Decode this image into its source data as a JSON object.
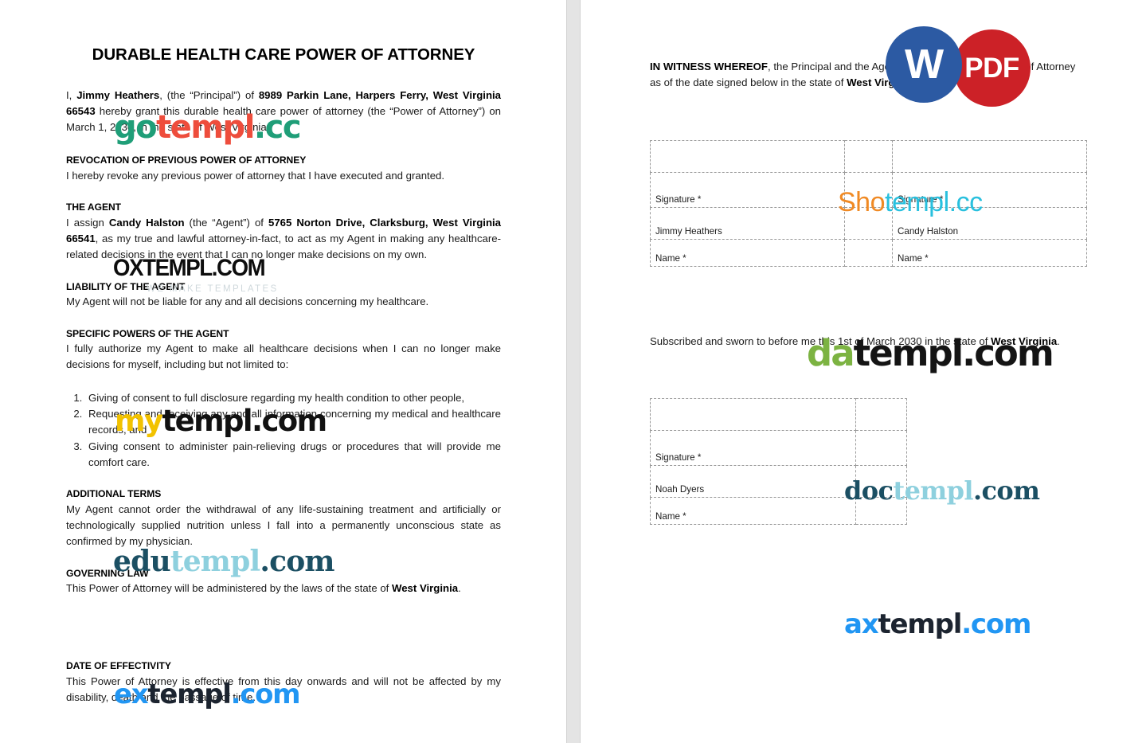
{
  "document": {
    "title": "DURABLE HEALTH CARE POWER OF ATTORNEY",
    "intro": {
      "lead": "I, ",
      "principal_name": "Jimmy Heathers",
      "mid1": ", (the “Principal”) of ",
      "principal_address": "8989 Parkin Lane, Harpers Ferry, West Virginia 66543",
      "tail": " hereby grant this durable health care power of attorney (the “Power of Attorney”) on March 1, 2030, in the state of West Virginia."
    },
    "sections": {
      "revocation": {
        "heading": "REVOCATION OF PREVIOUS POWER OF ATTORNEY",
        "body": "I hereby revoke any previous power of attorney that I have executed and granted."
      },
      "agent": {
        "heading": "THE AGENT",
        "lead": "I assign ",
        "agent_name": "Candy Halston",
        "mid": " (the “Agent”) of ",
        "agent_address": "5765 Norton Drive, Clarksburg, West Virginia 66541",
        "tail": ", as my true and lawful attorney-in-fact, to act as my Agent in making any healthcare-related decisions in the event that I can no longer make decisions on my own."
      },
      "liability": {
        "heading": "LIABILITY OF THE AGENT",
        "body": "My Agent will not be liable for any and all decisions concerning my healthcare."
      },
      "specific_powers": {
        "heading": "SPECIFIC POWERS OF THE AGENT",
        "body": "I fully authorize my Agent to make all healthcare decisions when I can no longer make decisions for myself, including but not limited to:",
        "items": [
          "Giving of consent to full disclosure regarding my health condition to other people,",
          "Requesting and receiving any and all information concerning my medical and healthcare records, and",
          "Giving consent to administer pain-relieving drugs or procedures that will provide me comfort care."
        ]
      },
      "additional_terms": {
        "heading": "ADDITIONAL TERMS",
        "body": "My Agent cannot order the withdrawal of any life-sustaining treatment and artificially or technologically supplied nutrition unless I fall into a permanently unconscious state as confirmed by my physician."
      },
      "governing_law": {
        "heading": "GOVERNING LAW",
        "lead": "This Power of Attorney will be administered by the laws of the state of ",
        "state": "West Virginia",
        "tail": "."
      },
      "date_of_effectivity": {
        "heading": "DATE OF EFFECTIVITY",
        "body": "This Power of Attorney is effective from this day onwards and will not be affected by my disability, death and the passage of time."
      }
    },
    "page2": {
      "witness": {
        "lead_bold": "IN WITNESS WHEREOF",
        "mid": ", the Principal and the Agent have executed this Power of Attorney as of the date signed below in the state of ",
        "state": "West Virginia",
        "tail": "."
      },
      "signature_table": {
        "left": {
          "signature_label": "Signature *",
          "name_value": "Jimmy Heathers",
          "name_label": "Name *"
        },
        "right": {
          "signature_label": "Signature *",
          "name_value": "Candy Halston",
          "name_label": "Name *"
        }
      },
      "notary": {
        "lead": "Subscribed and sworn to before me this 1st of March 2030 in the state of ",
        "state": "West Virginia",
        "tail": "."
      },
      "notary_table": {
        "signature_label": "Signature *",
        "name_value": "Noah Dyers",
        "name_label": "Name *"
      }
    }
  },
  "badges": {
    "word": {
      "label": "W",
      "color": "#2c5aa3"
    },
    "pdf": {
      "label": "PDF",
      "color": "#cc2127"
    }
  },
  "watermarks": {
    "gotempl": {
      "p1": "go",
      "p2": "templ",
      "p3": ".cc"
    },
    "oxtempl": {
      "main": "OXTEMPL.COM",
      "sub": "WE MAKE TEMPLATES"
    },
    "mytempl": {
      "p1": "my",
      "p2": "templ.com"
    },
    "edutempl": {
      "p1": "edu",
      "p2": "templ",
      "p3": ".com"
    },
    "extempl": {
      "p1": "ex",
      "p2": "templ",
      "p3": ".com"
    },
    "shotempl": {
      "p1": "Sho",
      "p2": "templ.cc"
    },
    "datempl": {
      "p1": "da",
      "p2": "templ.com"
    },
    "doctempl": {
      "p1": "doc",
      "p2": "templ",
      "p3": ".com"
    },
    "axtempl": {
      "p1": "ax",
      "p2": "templ",
      "p3": ".com"
    }
  }
}
